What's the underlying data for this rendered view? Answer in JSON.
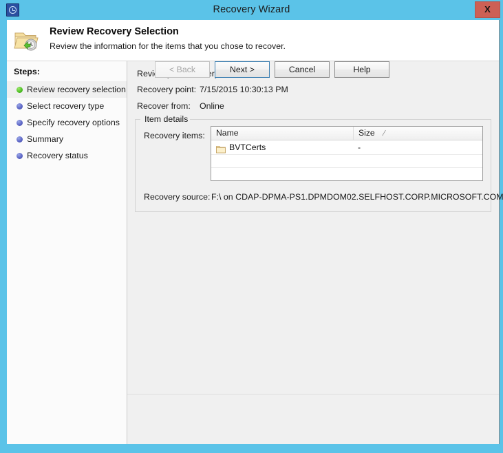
{
  "window": {
    "title": "Recovery Wizard",
    "app_icon": "restore-clock-icon",
    "close_label": "X"
  },
  "header": {
    "icon": "folder-restore-icon",
    "title": "Review Recovery Selection",
    "subtitle": "Review the information for the items that you chose to recover."
  },
  "sidebar": {
    "heading": "Steps:",
    "items": [
      {
        "label": "Review recovery selection",
        "state": "current",
        "bullet": "green"
      },
      {
        "label": "Select recovery type",
        "state": "pending",
        "bullet": "blue"
      },
      {
        "label": "Specify recovery options",
        "state": "pending",
        "bullet": "blue"
      },
      {
        "label": "Summary",
        "state": "pending",
        "bullet": "blue"
      },
      {
        "label": "Recovery status",
        "state": "pending",
        "bullet": "blue"
      }
    ]
  },
  "content": {
    "intro": "Review your recovery selections.",
    "recovery_point_label": "Recovery point:",
    "recovery_point_value": "7/15/2015 10:30:13 PM",
    "recover_from_label": "Recover from:",
    "recover_from_value": "Online",
    "group_title": "Item details",
    "recovery_items_label": "Recovery items:",
    "list": {
      "columns": [
        {
          "label": "Name",
          "sort_mark": ""
        },
        {
          "label": "Size",
          "sort_mark": "/"
        }
      ],
      "rows": [
        {
          "icon": "folder-icon",
          "name": "BVTCerts",
          "size": "-"
        }
      ]
    },
    "recovery_source_label": "Recovery source:",
    "recovery_source_value": "F:\\ on CDAP-DPMA-PS1.DPMDOM02.SELFHOST.CORP.MICROSOFT.COM"
  },
  "footer": {
    "back_label": "< Back",
    "next_label": "Next >",
    "cancel_label": "Cancel",
    "help_label": "Help"
  },
  "colors": {
    "title_bar": "#5bc3e8",
    "close_button": "#cd6055",
    "panel": "#f0f0f0",
    "sidebar": "#fbfbfb",
    "focus_border": "#3c7fb1",
    "bullet_current": "#4bbd22",
    "bullet_pending": "#5a63c4"
  }
}
